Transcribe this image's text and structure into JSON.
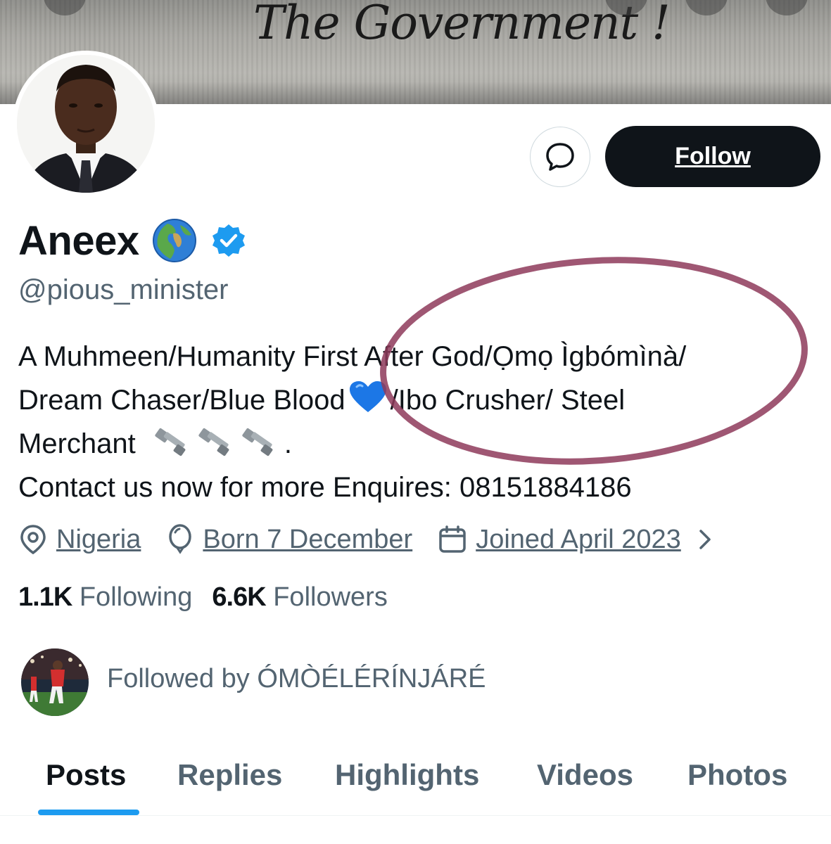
{
  "banner": {
    "graffiti_text": "The Government !"
  },
  "profile": {
    "display_name": "Aneex",
    "handle": "@pious_minister",
    "name_icons": [
      "globe-emoji",
      "verified-badge"
    ]
  },
  "actions": {
    "message_icon": "message-bubble-icon",
    "follow_label": "Follow"
  },
  "bio": {
    "line1": "A Muhmeen/Humanity First After God/Ọmọ Ìgbómìnà/",
    "line2_a": "Dream Chaser/Blue Blood",
    "line2_b": "/Ibo Crusher/ Steel",
    "line3_a": "Merchant",
    "line3_b": ".",
    "line4": "Contact us now for more Enquires: 08151884186"
  },
  "meta": {
    "location": "Nigeria",
    "birthday": "Born 7 December",
    "joined": "Joined April 2023"
  },
  "stats": {
    "following_count": "1.1K",
    "following_label": "Following",
    "followers_count": "6.6K",
    "followers_label": "Followers"
  },
  "followed_by": {
    "text": "Followed by ÓMÒÉLÉRÍNJÁRÉ"
  },
  "tabs": [
    {
      "label": "Posts",
      "active": true
    },
    {
      "label": "Replies",
      "active": false
    },
    {
      "label": "Highlights",
      "active": false
    },
    {
      "label": "Videos",
      "active": false
    },
    {
      "label": "Photos",
      "active": false
    }
  ],
  "colors": {
    "text_primary": "#0f1419",
    "text_secondary": "#536471",
    "accent": "#1d9bf0",
    "annotation": "#8e3a5a"
  }
}
